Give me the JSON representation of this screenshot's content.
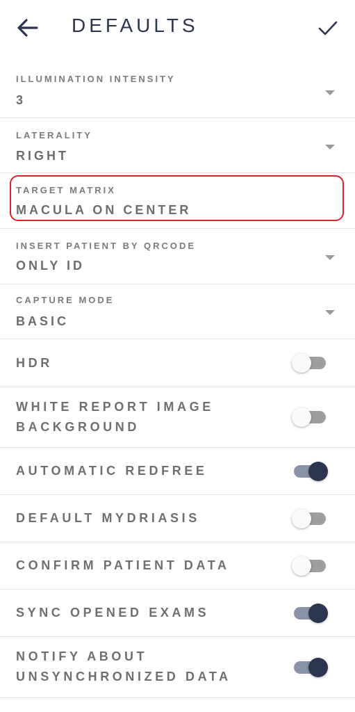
{
  "header": {
    "title": "DEFAULTS",
    "back_icon": "arrow-left-icon",
    "confirm_icon": "checkmark-icon",
    "accent_color": "#2b3550"
  },
  "dropdowns": [
    {
      "label": "ILLUMINATION INTENSITY",
      "value": "3"
    },
    {
      "label": "LATERALITY",
      "value": "RIGHT"
    },
    {
      "label": "TARGET MATRIX",
      "value": "MACULA ON CENTER"
    },
    {
      "label": "INSERT PATIENT BY QRCODE",
      "value": "ONLY ID"
    },
    {
      "label": "CAPTURE MODE",
      "value": "BASIC"
    }
  ],
  "toggles": [
    {
      "label": "HDR",
      "on": false
    },
    {
      "label_line1": "WHITE REPORT IMAGE",
      "label_line2": "BACKGROUND",
      "on": false
    },
    {
      "label": "AUTOMATIC REDFREE",
      "on": true
    },
    {
      "label": "DEFAULT MYDRIASIS",
      "on": false
    },
    {
      "label": "CONFIRM PATIENT DATA",
      "on": false
    },
    {
      "label": "SYNC OPENED EXAMS",
      "on": true
    },
    {
      "label_line1": "NOTIFY ABOUT",
      "label_line2": "UNSYNCHRONIZED DATA",
      "on": true
    }
  ],
  "highlight_color": "#e11e2a"
}
